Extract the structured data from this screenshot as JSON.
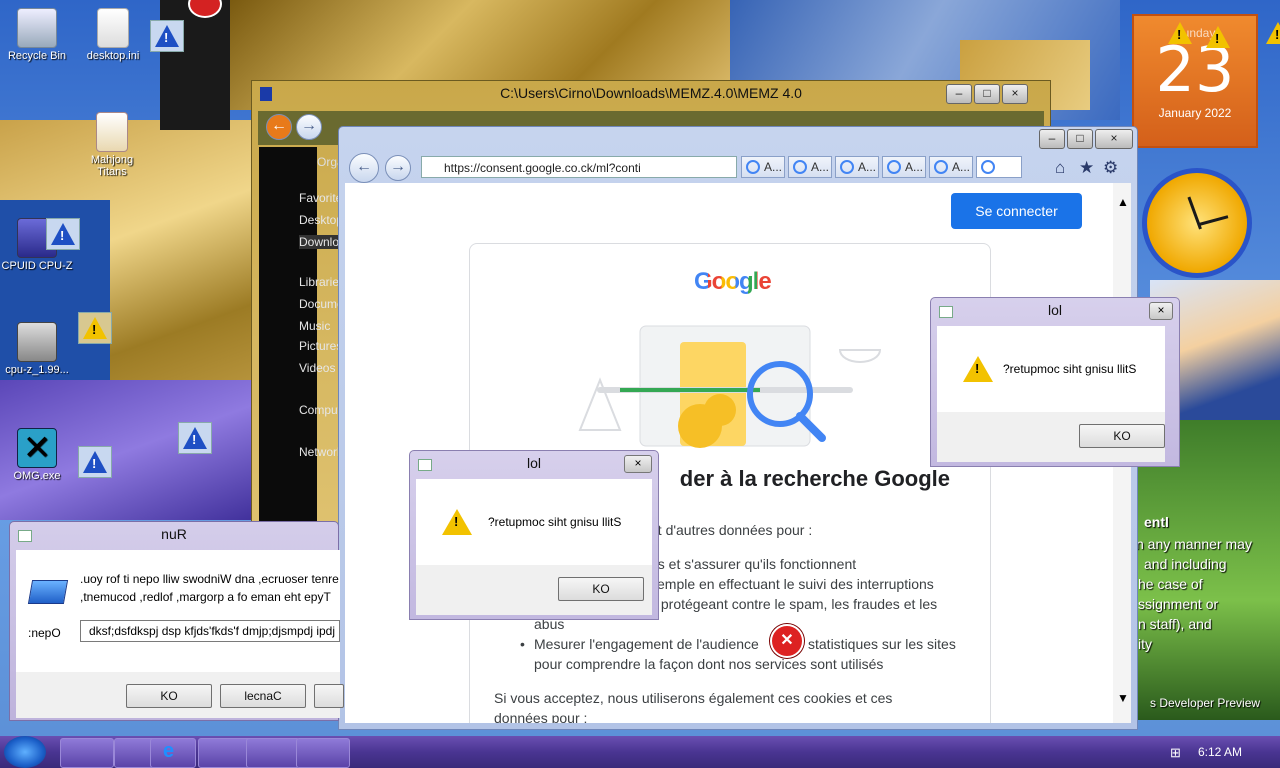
{
  "desktop": {
    "icons": [
      {
        "label": "Recycle Bin"
      },
      {
        "label": "desktop.ini"
      },
      {
        "label": "Mahjong Titans"
      },
      {
        "label": "CPUID CPU-Z"
      },
      {
        "label": "cpu-z_1.99..."
      },
      {
        "label": "OMG.exe"
      }
    ],
    "background_text": [
      "entl",
      "n any manner may",
      "and including",
      "he case of",
      "ssignment or",
      "n staff), and",
      "ity",
      "s Developer Preview"
    ]
  },
  "calendar": {
    "weekday": "Sunday",
    "day": "23",
    "month_year": "January 2022"
  },
  "explorer": {
    "title": "C:\\Users\\Cirno\\Downloads\\MEMZ.4.0\\MEMZ 4.0",
    "organize_label": "Organize",
    "nav_items": [
      "Favorites",
      "Desktop",
      "Downloads",
      "Libraries",
      "Documents",
      "Music",
      "Pictures",
      "Videos",
      "Computer",
      "Network"
    ]
  },
  "browser": {
    "url": "https://consent.google.co.ck/ml?conti",
    "tab_labels": [
      "A...",
      "A...",
      "A...",
      "A...",
      "A...",
      ""
    ],
    "signin_label": "Se connecter",
    "google_logo": "Google",
    "heading": "der à la recherche Google",
    "intro": "et d'autres données pour :",
    "bullets": [
      "es et s'assurer qu'ils fonctionnent",
      "xemple en effectuant le suivi des interruptions",
      "s protégeant contre le spam, les fraudes et les",
      "abus",
      "Mesurer l'engagement de l'audience",
      "statistiques sur les sites",
      "pour comprendre la façon dont nos services sont utilisés"
    ],
    "outro": "Si vous acceptez, nous utiliserons également ces cookies et ces",
    "outro2": "données pour :"
  },
  "dialog_left": {
    "title": "lol",
    "message": "?retupmoc siht gnisu llitS",
    "ok_label": "KO",
    "close": "×"
  },
  "dialog_right": {
    "title": "lol",
    "message": "?retupmoc siht gnisu llitS",
    "ok_label": "KO",
    "close": "×"
  },
  "run_dialog": {
    "title": "nuR",
    "line1": ".uoy rof ti nepo lliw swodniW dna ,ecruoser tenre",
    "line2": ",tnemucod ,redlof ,margorp a fo eman eht epyT",
    "open_label": ":nepO",
    "open_value": "dksf;dsfdkspj dsp kfjds'fkds'f dmjp;djsmpdj ipdj",
    "ok_label": "KO",
    "cancel_label": "lecnaC"
  },
  "taskbar": {
    "time": "6:12 AM"
  }
}
